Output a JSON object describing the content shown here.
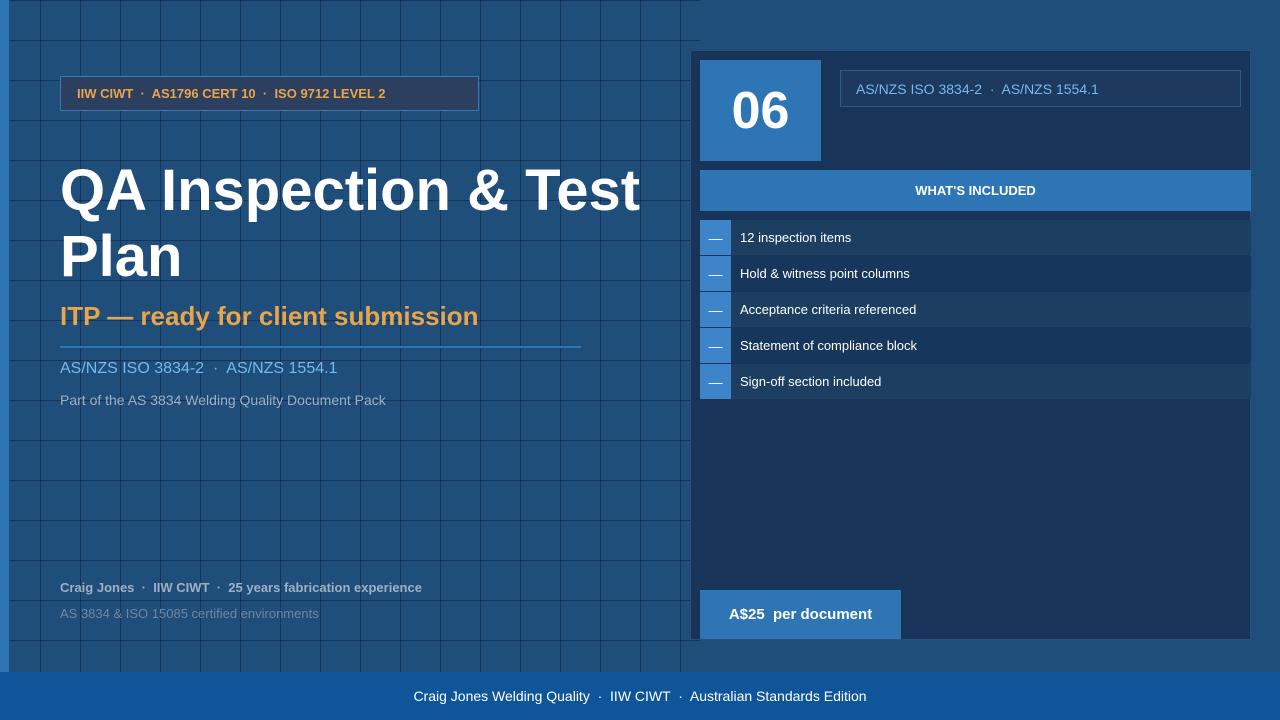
{
  "left": {
    "cert_badge": "IIW CIWT  ·  AS1796 CERT 10  ·  ISO 9712 LEVEL 2",
    "title": "QA Inspection & Test Plan",
    "subtitle": "ITP — ready for client submission",
    "standards": "AS/NZS ISO 3834-2  ·  AS/NZS 1554.1",
    "pack_note": "Part of the AS 3834 Welding Quality Document Pack",
    "author": "Craig Jones  ·  IIW CIWT  ·  25 years fabrication experience",
    "cert_env": "AS 3834 & ISO 15085 certified environments"
  },
  "panel": {
    "number": "06",
    "standards_tag": "AS/NZS ISO 3834-2  ·  AS/NZS 1554.1",
    "included_header": "WHAT'S INCLUDED",
    "bullet": "—",
    "items": [
      {
        "label": "12 inspection items"
      },
      {
        "label": "Hold & witness point columns"
      },
      {
        "label": "Acceptance criteria referenced"
      },
      {
        "label": "Statement of compliance block"
      },
      {
        "label": "Sign-off section included"
      }
    ],
    "price_label": "A$25  per document"
  },
  "footer": {
    "text": "Craig Jones Welding Quality  ·  IIW CIWT  ·  Australian Standards Edition"
  },
  "colors": {
    "background": "#1f4e7a",
    "accent": "#2e75b6",
    "highlight": "#e8a54c",
    "standards_text": "#74b9ef"
  }
}
